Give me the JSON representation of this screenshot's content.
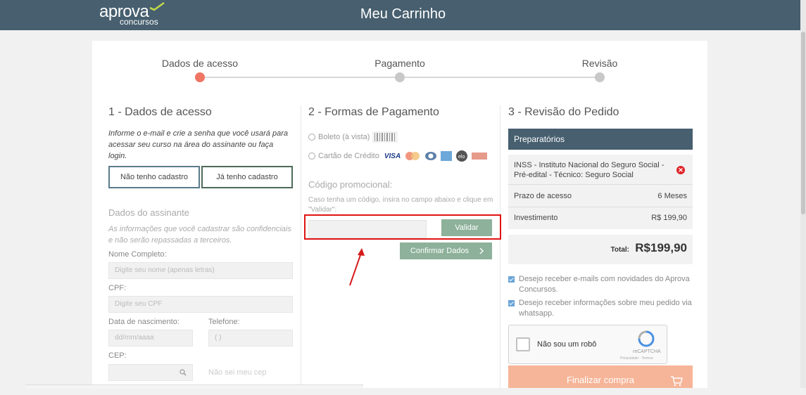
{
  "header": {
    "logo_main": "aprova",
    "logo_sub": "concursos",
    "title": "Meu Carrinho"
  },
  "steps": [
    "Dados de acesso",
    "Pagamento",
    "Revisão"
  ],
  "col1": {
    "title": "1 - Dados de acesso",
    "intro": "Informe o e-mail e crie a senha que você usará para acessar seu curso na área do assinante ou faça login.",
    "btn_no_account": "Não tenho cadastro",
    "btn_has_account": "Já tenho cadastro",
    "section": "Dados do assinante",
    "section_note": "As informações que você cadastrar são confidenciais e não serão repassadas a terceiros.",
    "name_label": "Nome Completo:",
    "name_placeholder": "Digite seu nome (apenas letras)",
    "cpf_label": "CPF:",
    "cpf_placeholder": "Digite seu CPF",
    "birth_label": "Data de nascimento:",
    "birth_placeholder": "dd/mm/aaaa",
    "phone_label": "Telefone:",
    "phone_placeholder": "(   )",
    "cep_label": "CEP:",
    "cep_link": "Não sei meu cep"
  },
  "col2": {
    "title": "2 - Formas de Pagamento",
    "opt_boleto": "Boleto (à vista)",
    "opt_card": "Cartão de Crédito",
    "card_visa": "VISA",
    "promo_title": "Código promocional:",
    "promo_text": "Caso tenha um código, insira no campo abaixo e clique em \"Validar\":",
    "validate": "Validar",
    "confirm": "Confirmar Dados"
  },
  "col3": {
    "title": "3 - Revisão do Pedido",
    "section": "Preparatórios",
    "course": "INSS - Instituto Nacional do Seguro Social - Pré-edital - Técnico: Seguro Social",
    "access_label": "Prazo de acesso",
    "access_value": "6 Meses",
    "invest_label": "Investimento",
    "invest_value": "R$ 199,90",
    "total_label": "Total:",
    "total_value": "R$199,90",
    "check1": "Desejo receber e-mails com novidades do Aprova Concursos.",
    "check2": "Desejo receber informações sobre meu pedido via whatsapp.",
    "captcha": "Não sou um robô",
    "captcha_brand": "reCAPTCHA",
    "captcha_links": "Privacidade - Termos",
    "finalize": "Finalizar compra"
  },
  "colors": {
    "header": "#475f6f",
    "active_step": "#f07563",
    "accent_green": "#8db19a",
    "highlight": "#e01313",
    "finalize": "#f6b598"
  }
}
